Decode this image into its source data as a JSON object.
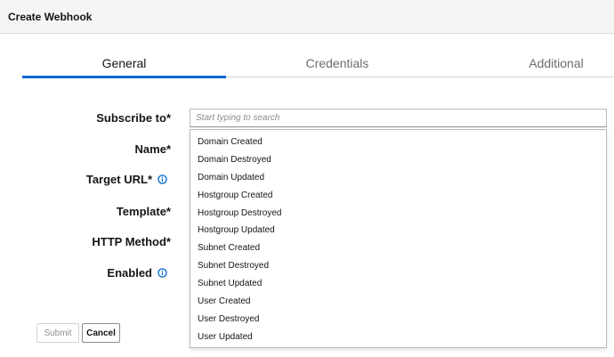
{
  "modal": {
    "title": "Create Webhook"
  },
  "tabs": [
    {
      "label": "General",
      "active": true
    },
    {
      "label": "Credentials",
      "active": false
    },
    {
      "label": "Additional",
      "active": false
    }
  ],
  "form": {
    "subscribe_label": "Subscribe to*",
    "name_label": "Name*",
    "target_url_label": "Target URL*",
    "template_label": "Template*",
    "http_method_label": "HTTP Method*",
    "enabled_label": "Enabled",
    "search_placeholder": "Start typing to search",
    "search_value": ""
  },
  "dropdown": {
    "items": [
      "Domain Created",
      "Domain Destroyed",
      "Domain Updated",
      "Hostgroup Created",
      "Hostgroup Destroyed",
      "Hostgroup Updated",
      "Subnet Created",
      "Subnet Destroyed",
      "Subnet Updated",
      "User Created",
      "User Destroyed",
      "User Updated"
    ]
  },
  "buttons": {
    "submit_label": "Submit",
    "cancel_label": "Cancel"
  },
  "icons": {
    "info": "info-circle-icon"
  },
  "colors": {
    "accent": "#0066cc",
    "info_icon": "#0066cc"
  }
}
